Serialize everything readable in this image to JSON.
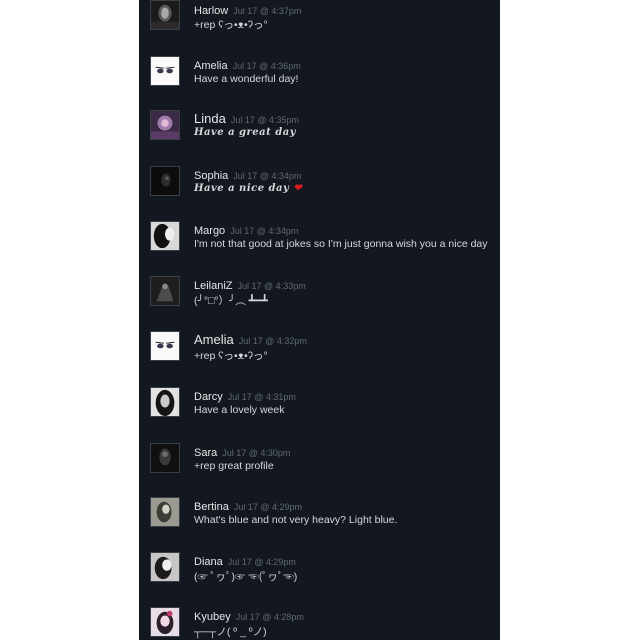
{
  "comments": [
    {
      "author": "Harlow",
      "time": "Jul 17 @ 4:37pm",
      "text": "+rep ʕっ•ᴥ•ʔっ°"
    },
    {
      "author": "Amelia",
      "time": "Jul 17 @ 4:36pm",
      "text": "Have a wonderful day!"
    },
    {
      "author": "Linda",
      "time": "Jul 17 @ 4:35pm",
      "text": "Have a great day"
    },
    {
      "author": "Sophia",
      "time": "Jul 17 @ 4:34pm",
      "text": "Have a nice day",
      "heart": "❤"
    },
    {
      "author": "Margo",
      "time": "Jul 17 @ 4:34pm",
      "text": "I'm not that good at jokes so I'm just gonna wish you a nice day"
    },
    {
      "author": "LeilaniZ",
      "time": "Jul 17 @ 4:33pm",
      "text": "(╯°□°）╯︵ ┻━┻"
    },
    {
      "author": "Amelia",
      "time": "Jul 17 @ 4:32pm",
      "text": "+rep ʕっ•ᴥ•ʔっ°"
    },
    {
      "author": "Darcy",
      "time": "Jul 17 @ 4:31pm",
      "text": "Have a lovely week"
    },
    {
      "author": "Sara",
      "time": "Jul 17 @ 4:30pm",
      "text": "+rep great profile"
    },
    {
      "author": "Bertina",
      "time": "Jul 17 @ 4:29pm",
      "text": "What's blue and not very heavy? Light blue."
    },
    {
      "author": "Diana",
      "time": "Jul 17 @ 4:29pm",
      "text": "(☞ ﾟヮﾟ)☞ ☜(ﾟヮﾟ☜)"
    },
    {
      "author": "Kyubey",
      "time": "Jul 17 @ 4:28pm",
      "text": "┬─┬ノ( º _ ºノ)"
    }
  ]
}
